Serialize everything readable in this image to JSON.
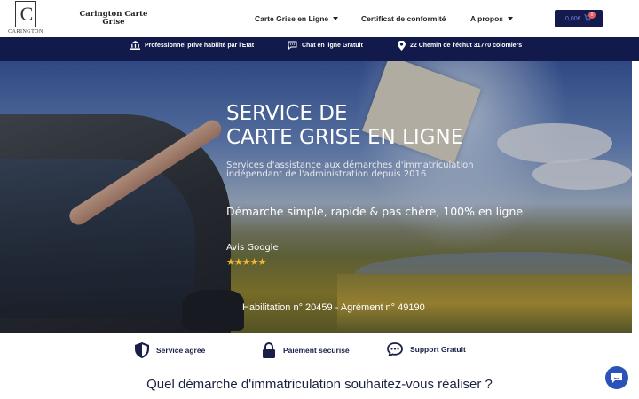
{
  "header": {
    "logo_letter": "C",
    "logo_text": "CARINGTON",
    "brand_line1": "Carington Carte",
    "brand_line2": "Grise",
    "nav": [
      {
        "label": "Carte Grise en Ligne",
        "has_dropdown": true
      },
      {
        "label": "Certificat de conformité",
        "has_dropdown": false
      },
      {
        "label": "A propos",
        "has_dropdown": true
      }
    ],
    "cart": {
      "total": "0,00€",
      "count": "0",
      "icon": "cart-icon"
    }
  },
  "topbar": {
    "items": [
      {
        "icon": "bank-icon",
        "label": "Professionnel privé habilité par l'Etat"
      },
      {
        "icon": "chat-bubble-icon",
        "label": "Chat en ligne Gratuit"
      },
      {
        "icon": "map-pin-icon",
        "label": "22 Chemin de l'échut 31770 colomiers"
      }
    ]
  },
  "hero": {
    "title_line1": "SERVICE DE",
    "title_line2": "CARTE GRISE EN LIGNE",
    "subtitle_line1": "Services d'assistance aux démarches d'immatriculation",
    "subtitle_line2": "indépendant de l'administration depuis 2016",
    "tagline": "Démarche simple, rapide & pas chère, 100% en ligne",
    "reviews_label": "Avis Google",
    "stars": "★★★★★",
    "rating": 5,
    "habilitation": "Habilitation n° 20459 - Agrément n° 49190"
  },
  "features": [
    {
      "icon": "shield-icon",
      "label": "Service agréé"
    },
    {
      "icon": "lock-icon",
      "label": "Paiement sécurisé"
    },
    {
      "icon": "support-chat-icon",
      "label": "Support Gratuit"
    }
  ],
  "question": "Quel démarche d'immatriculation souhaitez-vous réaliser ?",
  "colors": {
    "navy": "#121a4b",
    "cart_bg": "#141a4e",
    "badge": "#e35b5b",
    "stars": "#f6b830",
    "chat": "#2a52b8"
  }
}
